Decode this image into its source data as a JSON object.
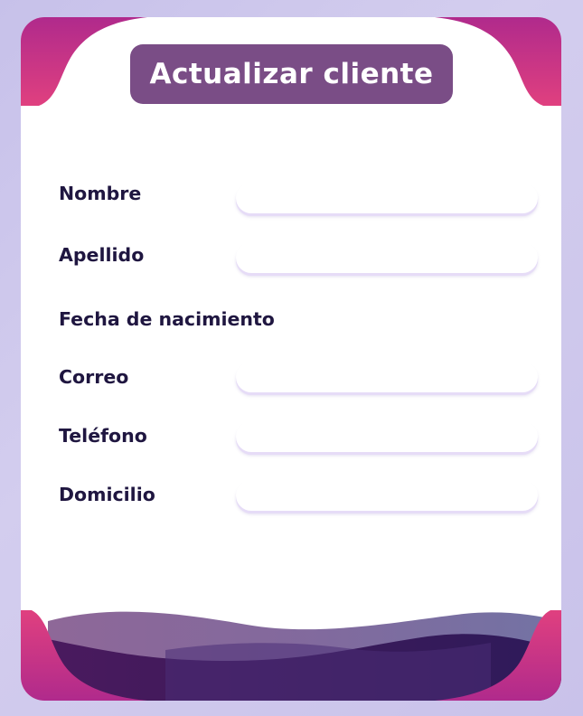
{
  "form": {
    "title": "Actualizar cliente",
    "fields": [
      {
        "label": "Nombre",
        "value": "",
        "has_input": true
      },
      {
        "label": "Apellido",
        "value": "",
        "has_input": true
      },
      {
        "label": "Fecha de nacimiento",
        "value": "",
        "has_input": false
      },
      {
        "label": "Correo",
        "value": "",
        "has_input": true
      },
      {
        "label": "Teléfono",
        "value": "",
        "has_input": true
      },
      {
        "label": "Domicilio",
        "value": "",
        "has_input": true
      }
    ]
  },
  "colors": {
    "background": "#cbc5ec",
    "card": "#ffffff",
    "title_box": "#7a4d86",
    "title_text": "#ffffff",
    "label_text": "#1f1640",
    "corner_pink": "#e0407f",
    "corner_magenta": "#b02a8c",
    "wave_dark_purple": "#3a1a5e",
    "wave_mid_purple": "#6a4a8e"
  }
}
